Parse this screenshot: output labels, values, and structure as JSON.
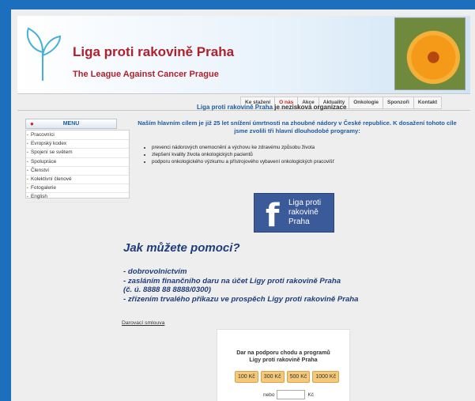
{
  "header": {
    "title_cz": "Liga proti rakovině Praha",
    "title_en": "The League Against Cancer Prague"
  },
  "topnav": {
    "items": [
      "Ke stažení",
      "O nás",
      "Akce",
      "Aktuality",
      "Onkologie",
      "Sponzoři",
      "Kontakt"
    ],
    "active_index": 1
  },
  "sidebar": {
    "menu_title": "MENU",
    "items": [
      "Pracovníci",
      "Evropský kodex",
      "Spojení se světem",
      "Spolupráce",
      "Členství",
      "Kolektivní členové",
      "Fotogalerie",
      "English"
    ]
  },
  "main": {
    "intro_name": "Liga proti rakovině Praha",
    "intro_rest": " je nezisková organizace",
    "goal": "Naším hlavním cílem je již 25 let snížení úmrtnosti na zhoubné nádory v České republice. K dosažení tohoto cíle jsme zvolili tři hlavní dlouhodobé programy:",
    "bullets": [
      "prevenci nádorových onemocnění a výchovu ke zdravému způsobu života",
      "zlepšení kvality života onkologických pacientů",
      "podporu onkologického výzkumu a přístrojového vybavení onkologických pracovišť"
    ],
    "facebook_label_1": "Liga proti",
    "facebook_label_2": "rakovině",
    "facebook_label_3": "Praha",
    "help_title": "Jak můžete pomoci?",
    "help_items": [
      "- dobrovolnictvím",
      "- zasláním finančního daru na účet Ligy proti rakovině Praha",
      "(č. ú. 8888 88 8888/0300)",
      "- zřízením trvalého příkazu ve prospěch Ligy proti rakovině Praha"
    ],
    "donation_link": "Darovací smlouva"
  },
  "donate": {
    "title_1": "Dar na podporu chodu a programů",
    "title_2": "Ligy proti rakovině Praha",
    "amounts": [
      "100 Kč",
      "300 Kč",
      "500 Kč",
      "1000 Kč"
    ],
    "other_label": "nebo",
    "currency": "Kč",
    "input_value": ""
  },
  "colors": {
    "brand_red": "#b0202e",
    "link_blue": "#1f5aa0",
    "facebook_blue": "#3b5a9a",
    "amount_button": "#f5c87a"
  }
}
